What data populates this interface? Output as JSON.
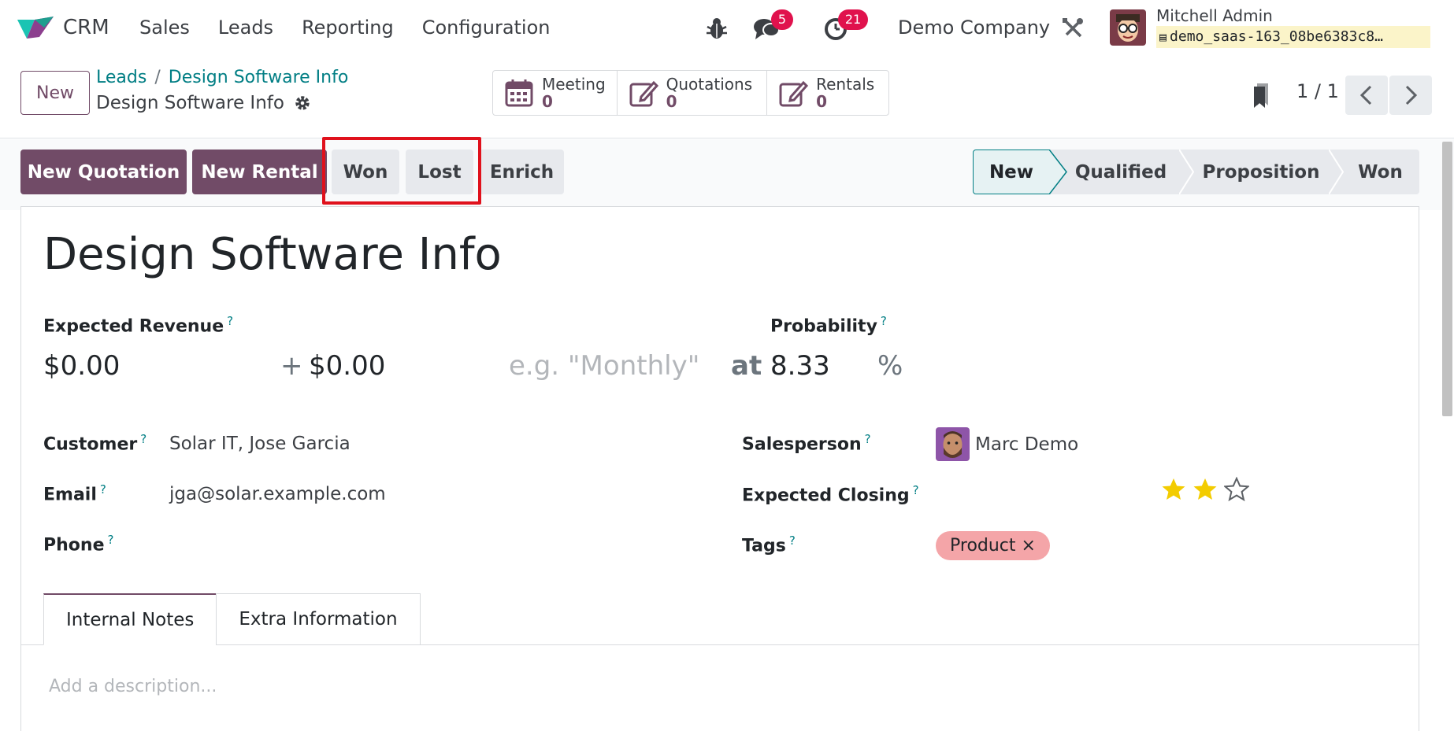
{
  "navbar": {
    "app_name": "CRM",
    "menu": [
      "Sales",
      "Leads",
      "Reporting",
      "Configuration"
    ],
    "messages_count": "5",
    "activities_count": "21",
    "company": "Demo Company",
    "user_name": "Mitchell Admin",
    "db_name": "demo_saas-163_08be6383c8…",
    "accent_color": "#714b67"
  },
  "control": {
    "new_label": "New",
    "breadcrumb": [
      "Leads",
      "Design Software Info"
    ],
    "record_title": "Design Software Info",
    "smart_buttons": [
      {
        "label": "Meeting",
        "count": "0"
      },
      {
        "label": "Quotations",
        "count": "0"
      },
      {
        "label": "Rentals",
        "count": "0"
      }
    ],
    "pager": "1 / 1"
  },
  "actions": {
    "new_quotation": "New Quotation",
    "new_rental": "New Rental",
    "won": "Won",
    "lost": "Lost",
    "enrich": "Enrich"
  },
  "stages": [
    "New",
    "Qualified",
    "Proposition",
    "Won"
  ],
  "form": {
    "lead_name": "Design Software Info",
    "expected_revenue_label": "Expected Revenue",
    "expected_revenue": "$0.00",
    "plus": "+",
    "recurring_revenue": "$0.00",
    "recurring_plan_placeholder": "e.g. \"Monthly\"",
    "at": "at",
    "probability_label": "Probability",
    "probability": "8.33",
    "percent": "%",
    "customer_label": "Customer",
    "customer": "Solar IT, Jose Garcia",
    "email_label": "Email",
    "email": "jga@solar.example.com",
    "phone_label": "Phone",
    "salesperson_label": "Salesperson",
    "salesperson": "Marc Demo",
    "expected_closing_label": "Expected Closing",
    "priority_stars": 2,
    "priority_max": 3,
    "tags_label": "Tags",
    "tag": "Product ×",
    "help_mark": "?"
  },
  "tabs": [
    "Internal Notes",
    "Extra Information"
  ],
  "description_placeholder": "Add a description..."
}
